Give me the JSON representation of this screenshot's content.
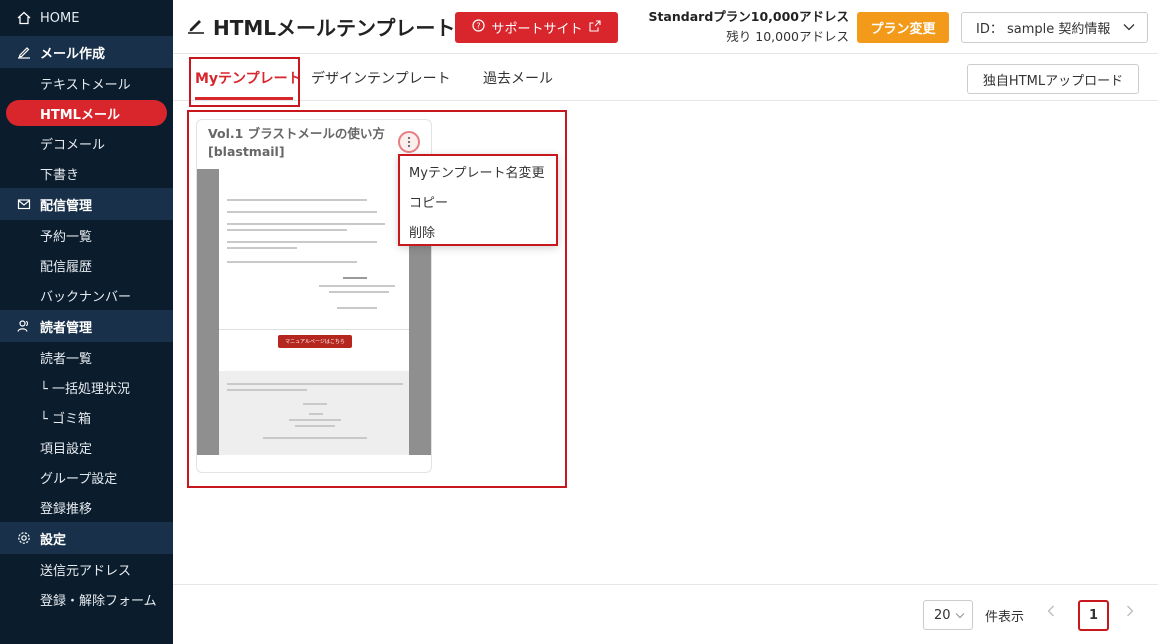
{
  "sidebar": {
    "home": "HOME",
    "sections": [
      {
        "label": "メール作成",
        "items": [
          "テキストメール",
          "HTMLメール",
          "デコメール",
          "下書き"
        ]
      },
      {
        "label": "配信管理",
        "items": [
          "予約一覧",
          "配信履歴",
          "バックナンバー"
        ]
      },
      {
        "label": "読者管理",
        "items": [
          "読者一覧",
          "└ 一括処理状況",
          "└ ゴミ箱",
          "項目設定",
          "グループ設定",
          "登録推移"
        ]
      },
      {
        "label": "設定",
        "items": [
          "送信元アドレス",
          "登録・解除フォーム"
        ]
      }
    ],
    "active_item": "HTMLメール"
  },
  "header": {
    "title": "HTMLメールテンプレート",
    "support_label": "サポートサイト",
    "plan_name": "Standardプラン10,000アドレス",
    "plan_remaining": "残り 10,000アドレス",
    "plan_change_label": "プラン変更",
    "account_label": "ID： sample  契約情報"
  },
  "tabs": {
    "items": [
      "Myテンプレート",
      "デザインテンプレート",
      "過去メール"
    ],
    "active": "Myテンプレート",
    "upload_label": "独自HTMLアップロード"
  },
  "card": {
    "title": "Vol.1 ブラストメールの使い方 [blastmail]",
    "preview_button": "マニュアルページはこちら"
  },
  "menu": {
    "items": [
      "Myテンプレート名変更",
      "コピー",
      "削除"
    ]
  },
  "pagination": {
    "per_page": "20",
    "per_page_label": "件表示",
    "current_page": "1"
  },
  "colors": {
    "sidebar_bg": "#0b1c2d",
    "section_bg": "#183049",
    "accent_red": "#d9262c",
    "plan_orange": "#f39a1b"
  }
}
